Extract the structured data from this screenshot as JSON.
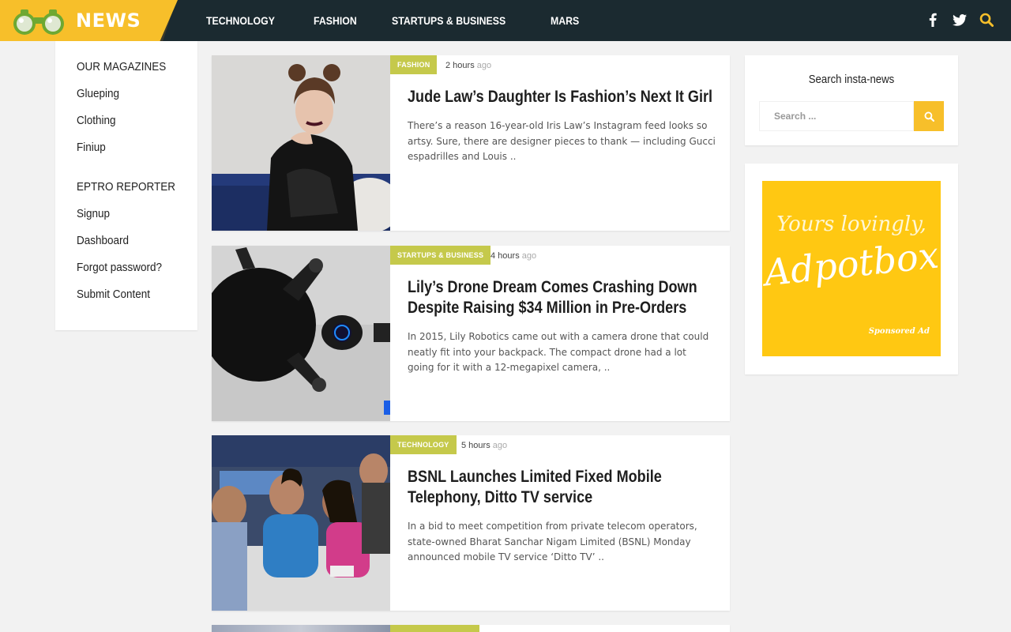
{
  "header": {
    "brand": "NEWS",
    "nav": [
      "TECHNOLOGY",
      "FASHION",
      "STARTUPS & BUSINESS",
      "MARS"
    ],
    "icons": [
      "facebook-icon",
      "twitter-icon",
      "search-icon"
    ]
  },
  "sidebar": {
    "section1": {
      "heading": "OUR MAGAZINES",
      "links": [
        "Glueping",
        "Clothing",
        "Finiup"
      ]
    },
    "section2": {
      "heading": "EPTRO REPORTER",
      "links": [
        "Signup",
        "Dashboard",
        "Forgot password?",
        "Submit Content"
      ]
    }
  },
  "articles": [
    {
      "category": "FASHION",
      "time": "2 hours",
      "ago": "ago",
      "title": "Jude Law’s Daughter Is Fashion’s Next It Girl",
      "excerpt": "There’s a reason 16-year-old Iris Law’s Instagram feed looks so artsy. Sure, there are designer pieces to thank — including Gucci espadrilles and Louis .."
    },
    {
      "category": "STARTUPS & BUSINESS",
      "time": "4 hours",
      "ago": "ago",
      "title": "Lily’s Drone Dream Comes Crashing Down Despite Raising $34 Million in Pre-Orders",
      "excerpt": "In 2015, Lily Robotics came out with a camera drone that could neatly fit into your backpack. The compact drone had a lot going for it with a 12-megapixel camera, .."
    },
    {
      "category": "TECHNOLOGY",
      "time": "5 hours",
      "ago": "ago",
      "title": "BSNL Launches Limited Fixed Mobile Telephony, Ditto TV service",
      "excerpt": "In a bid to meet competition from private telecom operators, state-owned Bharat Sanchar Nigam Limited (BSNL) Monday announced mobile TV service ‘Ditto TV’ .."
    }
  ],
  "search": {
    "title": "Search insta-news",
    "placeholder": "Search ..."
  },
  "ad": {
    "line1": "Yours lovingly,",
    "line2": "Adpotbox",
    "line3": "Sponsored Ad"
  },
  "colors": {
    "accent": "#f7bf2a",
    "header_bg": "#1b2a30",
    "category_bg": "#c5c94b"
  }
}
